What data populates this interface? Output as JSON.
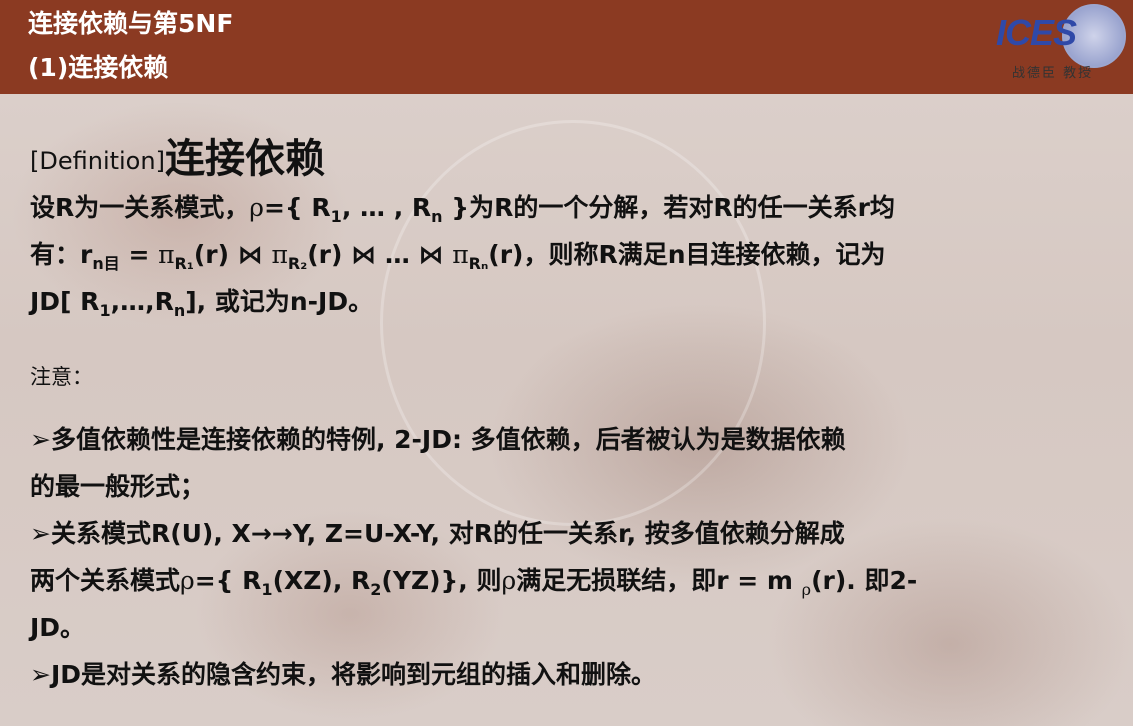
{
  "header": {
    "title": "连接依赖与第5NF",
    "subtitle": "(1)连接依赖",
    "logo_text": "ICES",
    "logo_caption": "战德臣 教授"
  },
  "definition": {
    "tag": "[Definition]",
    "title": "连接依赖"
  },
  "body": {
    "l1_a": "设R为一关系模式，",
    "l1_rho": "ρ",
    "l1_b": "={ R",
    "l1_s1": "1",
    "l1_c": ", … , R",
    "l1_sn": "n",
    "l1_d": " }为R的一个分解，若对R的任一关系r均",
    "l2_a": "有：r",
    "l2_s1": "n目",
    "l2_b": " = ",
    "l2_pi": "π",
    "l2_s2": "R₁",
    "l2_c": "(r)  ⋈ ",
    "l2_s3": "R₂",
    "l2_d": "(r) ⋈  … ⋈ ",
    "l2_s4": "Rₙ",
    "l2_e": "(r)，则称R满足n目连接依赖，记为",
    "l3_a": "JD[ R",
    "l3_s1": "1",
    "l3_b": ",…,R",
    "l3_sn": "n",
    "l3_c": "], 或记为n-JD。"
  },
  "notes": {
    "label": "注意：",
    "n1_a": "➢多值依赖性是连接依赖的特例, 2-JD: 多值依赖，后者被认为是数据依赖",
    "n1_b": "的最一般形式；",
    "n2_a": "➢关系模式R(U),  X→→Y,  Z=U-X-Y, 对R的任一关系r,  按多值依赖分解成",
    "n2_b1": "两个关系模式",
    "n2_rho": "ρ",
    "n2_b2": "={ R",
    "n2_s1": "1",
    "n2_b3": "(XZ), R",
    "n2_s2": "2",
    "n2_b4": "(YZ)}, 则",
    "n2_b5": "满足无损联结，即r = m ",
    "n2_s3": "ρ",
    "n2_b6": "(r). 即2-",
    "n2_c": "JD。",
    "n3": "➢JD是对关系的隐含约束，将影响到元组的插入和删除。"
  },
  "colors": {
    "header_bg": "#8b3a22",
    "body_bg": "#d8ccc6",
    "logo_blue": "#2f49a8"
  }
}
